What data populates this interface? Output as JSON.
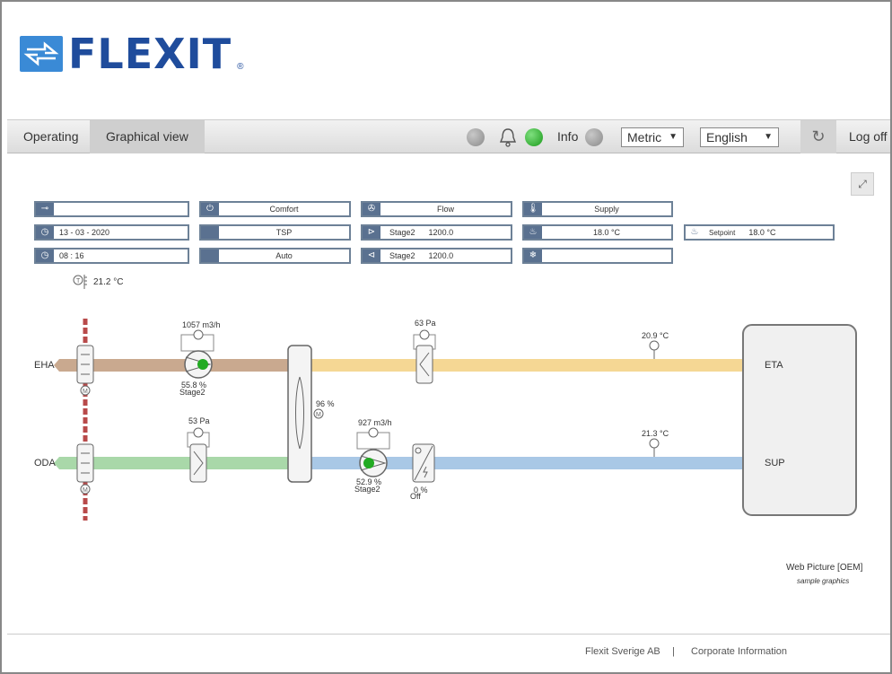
{
  "brand": {
    "name": "FLEXIT",
    "reg": "®"
  },
  "menu": {
    "tabs": [
      {
        "label": "Operating"
      },
      {
        "label": "Graphical view"
      }
    ],
    "info_label": "Info",
    "unit_select": "Metric",
    "language_select": "English",
    "logoff": "Log off"
  },
  "panel": {
    "row1": {
      "col1": "",
      "col2": "Comfort",
      "col3": "Flow",
      "col4": "Supply"
    },
    "row2": {
      "date": "13 - 03 - 2020",
      "col2": "TSP",
      "fan_stage": "Stage2",
      "fan_value": "1200.0",
      "heat_temp": "18.0 °C",
      "setpoint_label": "Setpoint",
      "setpoint_value": "18.0 °C"
    },
    "row3": {
      "time": "08 : 16",
      "col2": "Auto",
      "fan_stage": "Stage2",
      "fan_value": "1200.0",
      "col4": ""
    },
    "room_temp": "21.2 °C"
  },
  "diagram": {
    "eha_label": "EHA",
    "oda_label": "ODA",
    "eta_label": "ETA",
    "sup_label": "SUP",
    "exhaust_flow": "1057 m3/h",
    "exhaust_fan_pct": "55.8 %",
    "exhaust_fan_stage": "Stage2",
    "extract_filter_pa": "63 Pa",
    "eta_temp": "20.9 °C",
    "recovery_pct": "96 %",
    "outdoor_filter_pa": "53 Pa",
    "supply_flow": "927 m3/h",
    "supply_fan_pct": "52.9 %",
    "supply_fan_stage": "Stage2",
    "heater_pct": "0 %",
    "heater_state": "Off",
    "sup_temp": "21.3 °C"
  },
  "watermark": {
    "title": "Web Picture [OEM]",
    "subtitle": "sample graphics"
  },
  "footer": {
    "company": "Flexit Sverige AB",
    "separator": "|",
    "link": "Corporate Information"
  },
  "colors": {
    "brand_blue": "#1f4c9c",
    "exhaust_duct": "#c9a98f",
    "extract_duct": "#f5d794",
    "outdoor_duct": "#a9d8a9",
    "supply_duct": "#a9c8e6",
    "damper_wall": "#b84a4a",
    "fan_on": "#22aa22"
  }
}
